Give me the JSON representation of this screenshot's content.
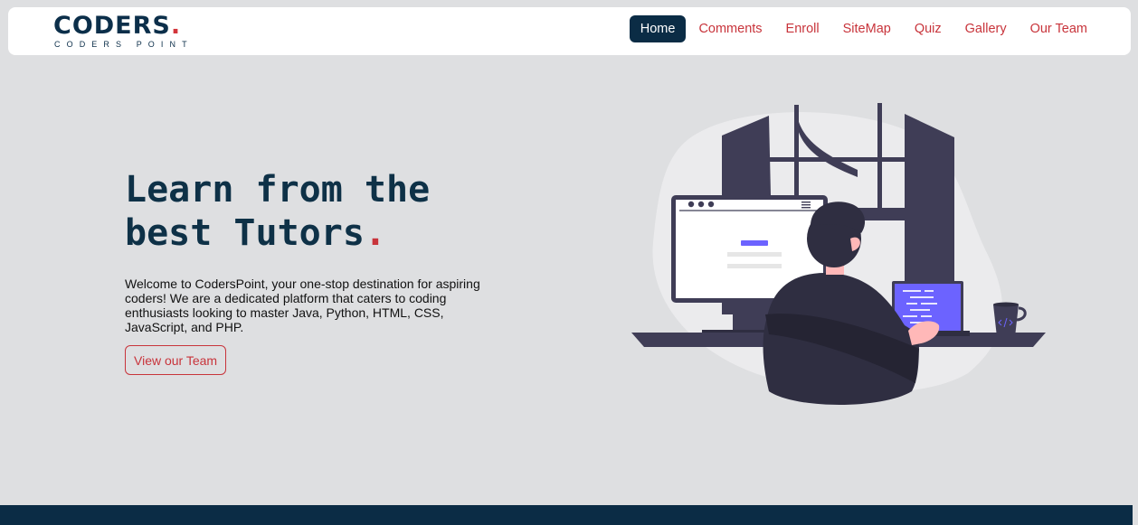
{
  "brand": {
    "name": "CODERS",
    "dot": ".",
    "tagline": "CODERS POINT"
  },
  "nav": {
    "items": [
      {
        "label": "Home",
        "active": true
      },
      {
        "label": "Comments"
      },
      {
        "label": "Enroll"
      },
      {
        "label": "SiteMap"
      },
      {
        "label": "Quiz"
      },
      {
        "label": "Gallery"
      },
      {
        "label": "Our Team"
      }
    ]
  },
  "hero": {
    "title_line1": "Learn from the",
    "title_line2": "best Tutors",
    "title_dot": ".",
    "description": "Welcome to CodersPoint, your one-stop destination for aspiring coders! We are a dedicated platform that caters to coding enthusiasts looking to master Java, Python, HTML, CSS, JavaScript, and PHP.",
    "cta_label": "View our Team"
  },
  "colors": {
    "navy": "#0b2c45",
    "accent": "#c8343b",
    "background": "#dedfe1",
    "illustration_dark": "#3f3d56",
    "illustration_purple": "#6c63ff"
  }
}
